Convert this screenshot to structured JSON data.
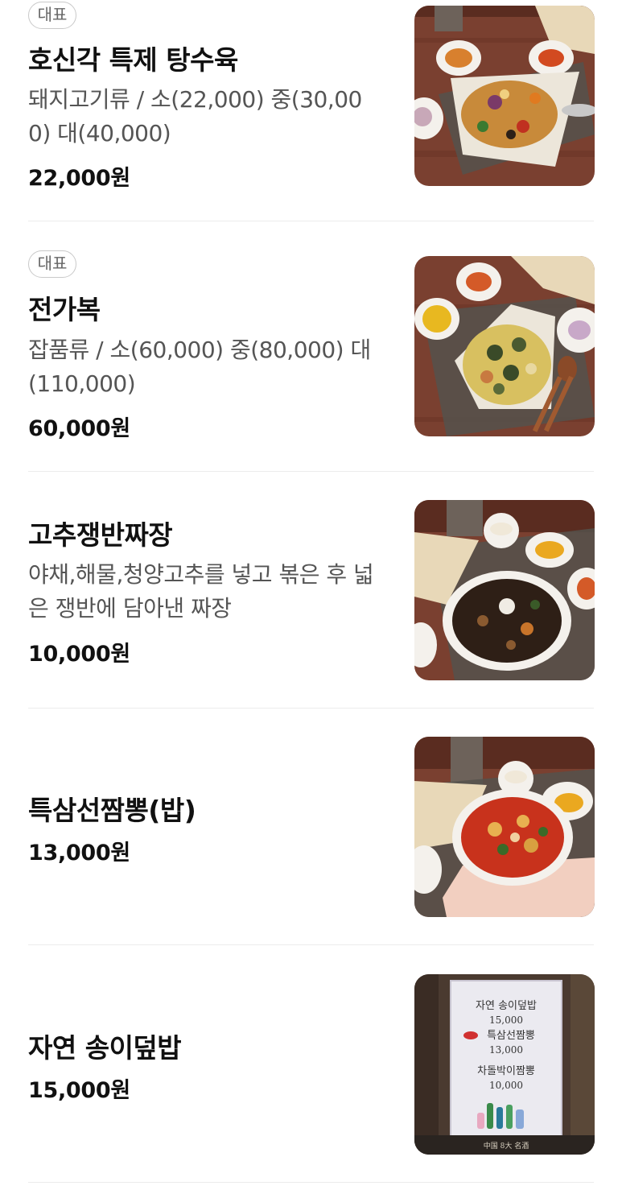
{
  "menu": {
    "items": [
      {
        "badge": "대표",
        "name": "호신각 특제 탕수육",
        "desc_line1": "돼지고기류 / 소(22,000) 중(30,00",
        "desc_line2": "0) 대(40,000)",
        "price": "22,000원",
        "photo": "sweet-and-sour-pork-photo"
      },
      {
        "badge": "대표",
        "name": "전가복",
        "desc_line1": "잡품류 / 소(60,000) 중(80,000) 대",
        "desc_line2": "(110,000)",
        "price": "60,000원",
        "photo": "jeongabok-photo"
      },
      {
        "name": "고추쟁반짜장",
        "desc_line1": "야채,해물,청양고추를 넣고 볶은 후 넓",
        "desc_line2": "은 쟁반에 담아낸 짜장",
        "price": "10,000원",
        "photo": "jjajang-photo"
      },
      {
        "name": "특삼선짬뽕(밥)",
        "price": "13,000원",
        "photo": "jjamppong-photo"
      },
      {
        "name": "자연 송이덮밥",
        "price": "15,000원",
        "photo": "menu-card-photo",
        "card_text": {
          "line1": "자연 송이덮밥",
          "line1_price": "15,000",
          "line2": "특삼선짬뽕",
          "line2_price": "13,000",
          "line3": "차돌박이짬뽕",
          "line3_price": "10,000",
          "footer": "中国 8大 名酒"
        }
      }
    ]
  }
}
